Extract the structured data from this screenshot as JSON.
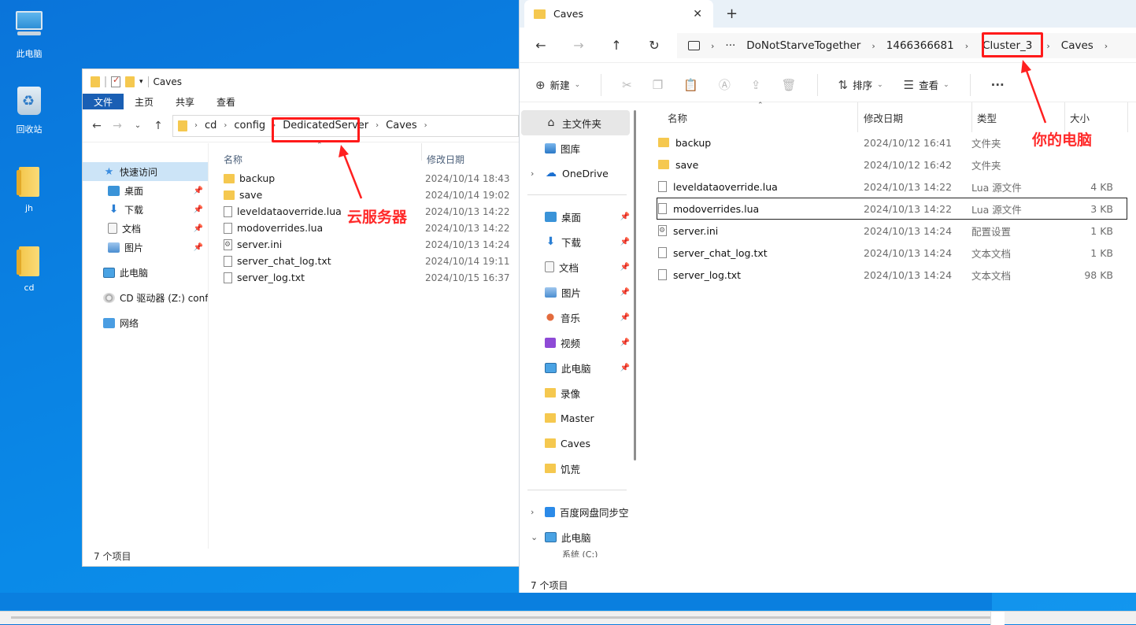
{
  "desktop": {
    "icons": [
      {
        "label": "此电脑"
      },
      {
        "label": "回收站"
      },
      {
        "label": "jh"
      },
      {
        "label": "cd"
      }
    ]
  },
  "left_window": {
    "title": "Caves",
    "ribbon_tabs": [
      "文件",
      "主页",
      "共享",
      "查看"
    ],
    "breadcrumb": [
      "cd",
      "config",
      "DedicatedServer",
      "Caves"
    ],
    "nav": {
      "quick_access": "快速访问",
      "items": [
        {
          "label": "桌面",
          "pinned": true
        },
        {
          "label": "下载",
          "pinned": true
        },
        {
          "label": "文档",
          "pinned": true
        },
        {
          "label": "图片",
          "pinned": true
        }
      ],
      "this_pc": "此电脑",
      "cd_drive": "CD 驱动器 (Z:) confi",
      "network": "网络"
    },
    "columns": {
      "name": "名称",
      "modified": "修改日期"
    },
    "files": [
      {
        "name": "backup",
        "type": "folder",
        "modified": "2024/10/14 18:43"
      },
      {
        "name": "save",
        "type": "folder",
        "modified": "2024/10/14 19:02"
      },
      {
        "name": "leveldataoverride.lua",
        "type": "file",
        "modified": "2024/10/13 14:22"
      },
      {
        "name": "modoverrides.lua",
        "type": "file",
        "modified": "2024/10/13 14:22"
      },
      {
        "name": "server.ini",
        "type": "ini",
        "modified": "2024/10/13 14:24"
      },
      {
        "name": "server_chat_log.txt",
        "type": "file",
        "modified": "2024/10/14 19:11"
      },
      {
        "name": "server_log.txt",
        "type": "file",
        "modified": "2024/10/15 16:37"
      }
    ],
    "status": "7 个项目"
  },
  "right_window": {
    "tab_title": "Caves",
    "breadcrumb": [
      "DoNotStarveTogether",
      "1466366681",
      "Cluster_3",
      "Caves"
    ],
    "commands": {
      "new": "新建",
      "sort": "排序",
      "view": "查看"
    },
    "side": {
      "home": "主文件夹",
      "gallery": "图库",
      "onedrive": "OneDrive",
      "pinned": [
        "桌面",
        "下载",
        "文档",
        "图片",
        "音乐",
        "视频",
        "此电脑"
      ],
      "folders": [
        "录像",
        "Master",
        "Caves",
        "饥荒"
      ],
      "baidu": "百度网盘同步空",
      "this_pc": "此电脑",
      "partial": "系统 (C:)"
    },
    "columns": {
      "name": "名称",
      "modified": "修改日期",
      "type": "类型",
      "size": "大小"
    },
    "files": [
      {
        "name": "backup",
        "icon": "folder",
        "modified": "2024/10/12 16:41",
        "type": "文件夹",
        "size": ""
      },
      {
        "name": "save",
        "icon": "folder",
        "modified": "2024/10/12 16:42",
        "type": "文件夹",
        "size": ""
      },
      {
        "name": "leveldataoverride.lua",
        "icon": "file",
        "modified": "2024/10/13 14:22",
        "type": "Lua 源文件",
        "size": "4 KB"
      },
      {
        "name": "modoverrides.lua",
        "icon": "file",
        "modified": "2024/10/13 14:22",
        "type": "Lua 源文件",
        "size": "3 KB"
      },
      {
        "name": "server.ini",
        "icon": "ini",
        "modified": "2024/10/13 14:24",
        "type": "配置设置",
        "size": "1 KB"
      },
      {
        "name": "server_chat_log.txt",
        "icon": "file",
        "modified": "2024/10/13 14:24",
        "type": "文本文档",
        "size": "1 KB"
      },
      {
        "name": "server_log.txt",
        "icon": "file",
        "modified": "2024/10/13 14:24",
        "type": "文本文档",
        "size": "98 KB"
      }
    ],
    "status": "7 个项目"
  },
  "annotations": {
    "cloud_server": "云服务器",
    "your_pc": "你的电脑",
    "color": "#ff1a1a"
  }
}
